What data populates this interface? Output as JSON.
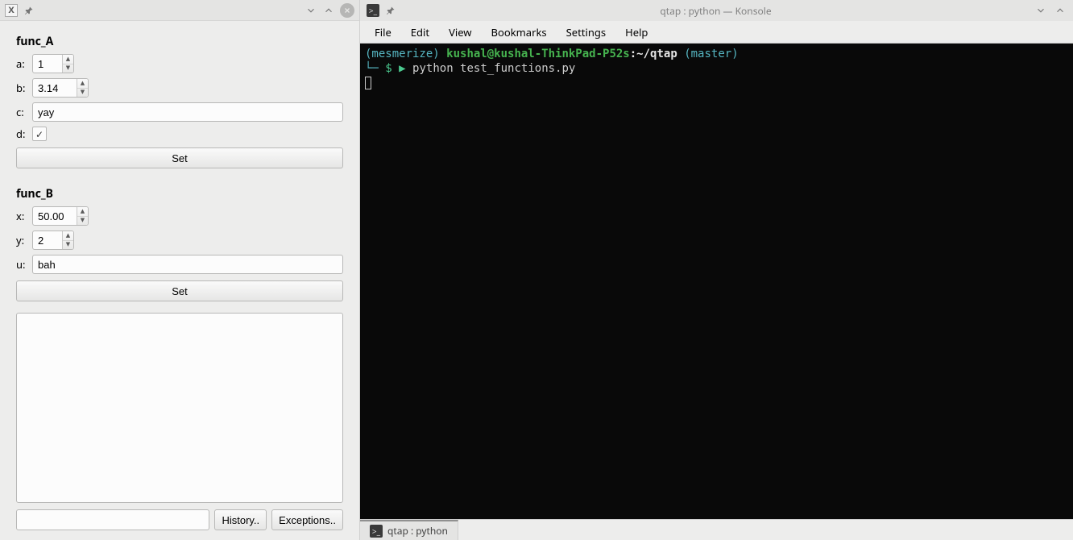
{
  "left_window": {
    "sections": {
      "funcA": {
        "title": "func_A",
        "fields": {
          "a": {
            "label": "a:",
            "value": "1"
          },
          "b": {
            "label": "b:",
            "value": "3.14"
          },
          "c": {
            "label": "c:",
            "value": "yay"
          },
          "d": {
            "label": "d:",
            "checked": true
          }
        },
        "set_label": "Set"
      },
      "funcB": {
        "title": "func_B",
        "fields": {
          "x": {
            "label": "x:",
            "value": "50.00"
          },
          "y": {
            "label": "y:",
            "value": "2"
          },
          "u": {
            "label": "u:",
            "value": "bah"
          }
        },
        "set_label": "Set"
      }
    },
    "bottom": {
      "command_value": "",
      "history_label": "History..",
      "exceptions_label": "Exceptions.."
    }
  },
  "konsole": {
    "title": "qtap : python — Konsole",
    "menu": [
      "File",
      "Edit",
      "View",
      "Bookmarks",
      "Settings",
      "Help"
    ],
    "terminal": {
      "env": "(mesmerize)",
      "userhost": "kushal@kushal-ThinkPad-P52s",
      "colon": ":",
      "cwd": "~/qtap",
      "branch": "(master)",
      "prompt_corner": "└─",
      "dollar": "$",
      "arrow": "▶",
      "command": "python test_functions.py"
    },
    "tab_label": "qtap : python"
  }
}
